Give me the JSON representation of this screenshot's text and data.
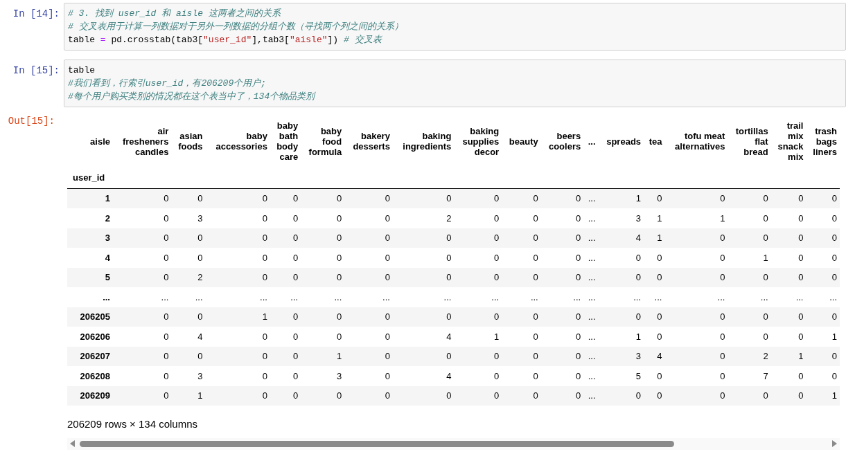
{
  "cells": [
    {
      "prompt": "In [14]:",
      "lines": [
        [
          {
            "kind": "comment",
            "text": "# 3. 找到 user_id 和 aisle 这两者之间的关系"
          }
        ],
        [
          {
            "kind": "comment",
            "text": "# 交叉表用于计算一列数据对于另外一列数据的分组个数（寻找两个列之间的关系）"
          }
        ],
        [
          {
            "kind": "code",
            "text": "table "
          },
          {
            "kind": "operator",
            "text": "="
          },
          {
            "kind": "code",
            "text": " pd.crosstab(tab3["
          },
          {
            "kind": "string",
            "text": "\"user_id\""
          },
          {
            "kind": "code",
            "text": "],tab3["
          },
          {
            "kind": "string",
            "text": "\"aisle\""
          },
          {
            "kind": "code",
            "text": "]) "
          },
          {
            "kind": "comment",
            "text": "# 交叉表"
          }
        ]
      ]
    },
    {
      "prompt": "In [15]:",
      "lines": [
        [
          {
            "kind": "code",
            "text": "table"
          }
        ],
        [
          {
            "kind": "comment",
            "text": "#我们看到，行索引user_id，有206209个用户;"
          }
        ],
        [
          {
            "kind": "comment",
            "text": "#每个用户购买类别的情况都在这个表当中了，134个物品类别"
          }
        ]
      ]
    }
  ],
  "output": {
    "prompt": "Out[15]:",
    "table": {
      "columns_name": "aisle",
      "index_name": "user_id",
      "columns": [
        "air\nfresheners\ncandles",
        "asian\nfoods",
        "baby\naccessories",
        "baby\nbath\nbody\ncare",
        "baby\nfood\nformula",
        "bakery\ndesserts",
        "baking\ningredients",
        "baking\nsupplies\ndecor",
        "beauty",
        "beers\ncoolers",
        "...",
        "spreads",
        "tea",
        "tofu meat\nalternatives",
        "tortillas\nflat\nbread",
        "trail\nmix\nsnack\nmix",
        "trash\nbags\nliners"
      ],
      "rows": [
        {
          "index": "1",
          "cells": [
            "0",
            "0",
            "0",
            "0",
            "0",
            "0",
            "0",
            "0",
            "0",
            "0",
            "...",
            "1",
            "0",
            "0",
            "0",
            "0",
            "0"
          ]
        },
        {
          "index": "2",
          "cells": [
            "0",
            "3",
            "0",
            "0",
            "0",
            "0",
            "2",
            "0",
            "0",
            "0",
            "...",
            "3",
            "1",
            "1",
            "0",
            "0",
            "0"
          ]
        },
        {
          "index": "3",
          "cells": [
            "0",
            "0",
            "0",
            "0",
            "0",
            "0",
            "0",
            "0",
            "0",
            "0",
            "...",
            "4",
            "1",
            "0",
            "0",
            "0",
            "0"
          ]
        },
        {
          "index": "4",
          "cells": [
            "0",
            "0",
            "0",
            "0",
            "0",
            "0",
            "0",
            "0",
            "0",
            "0",
            "...",
            "0",
            "0",
            "0",
            "1",
            "0",
            "0"
          ]
        },
        {
          "index": "5",
          "cells": [
            "0",
            "2",
            "0",
            "0",
            "0",
            "0",
            "0",
            "0",
            "0",
            "0",
            "...",
            "0",
            "0",
            "0",
            "0",
            "0",
            "0"
          ]
        },
        {
          "index": "...",
          "cells": [
            "...",
            "...",
            "...",
            "...",
            "...",
            "...",
            "...",
            "...",
            "...",
            "...",
            "...",
            "...",
            "...",
            "...",
            "...",
            "...",
            "..."
          ]
        },
        {
          "index": "206205",
          "cells": [
            "0",
            "0",
            "1",
            "0",
            "0",
            "0",
            "0",
            "0",
            "0",
            "0",
            "...",
            "0",
            "0",
            "0",
            "0",
            "0",
            "0"
          ]
        },
        {
          "index": "206206",
          "cells": [
            "0",
            "4",
            "0",
            "0",
            "0",
            "0",
            "4",
            "1",
            "0",
            "0",
            "...",
            "1",
            "0",
            "0",
            "0",
            "0",
            "1"
          ]
        },
        {
          "index": "206207",
          "cells": [
            "0",
            "0",
            "0",
            "0",
            "1",
            "0",
            "0",
            "0",
            "0",
            "0",
            "...",
            "3",
            "4",
            "0",
            "2",
            "1",
            "0"
          ]
        },
        {
          "index": "206208",
          "cells": [
            "0",
            "3",
            "0",
            "0",
            "3",
            "0",
            "4",
            "0",
            "0",
            "0",
            "...",
            "5",
            "0",
            "0",
            "7",
            "0",
            "0"
          ]
        },
        {
          "index": "206209",
          "cells": [
            "0",
            "1",
            "0",
            "0",
            "0",
            "0",
            "0",
            "0",
            "0",
            "0",
            "...",
            "0",
            "0",
            "0",
            "0",
            "0",
            "1"
          ]
        }
      ]
    },
    "summary": "206209 rows × 134 columns"
  }
}
